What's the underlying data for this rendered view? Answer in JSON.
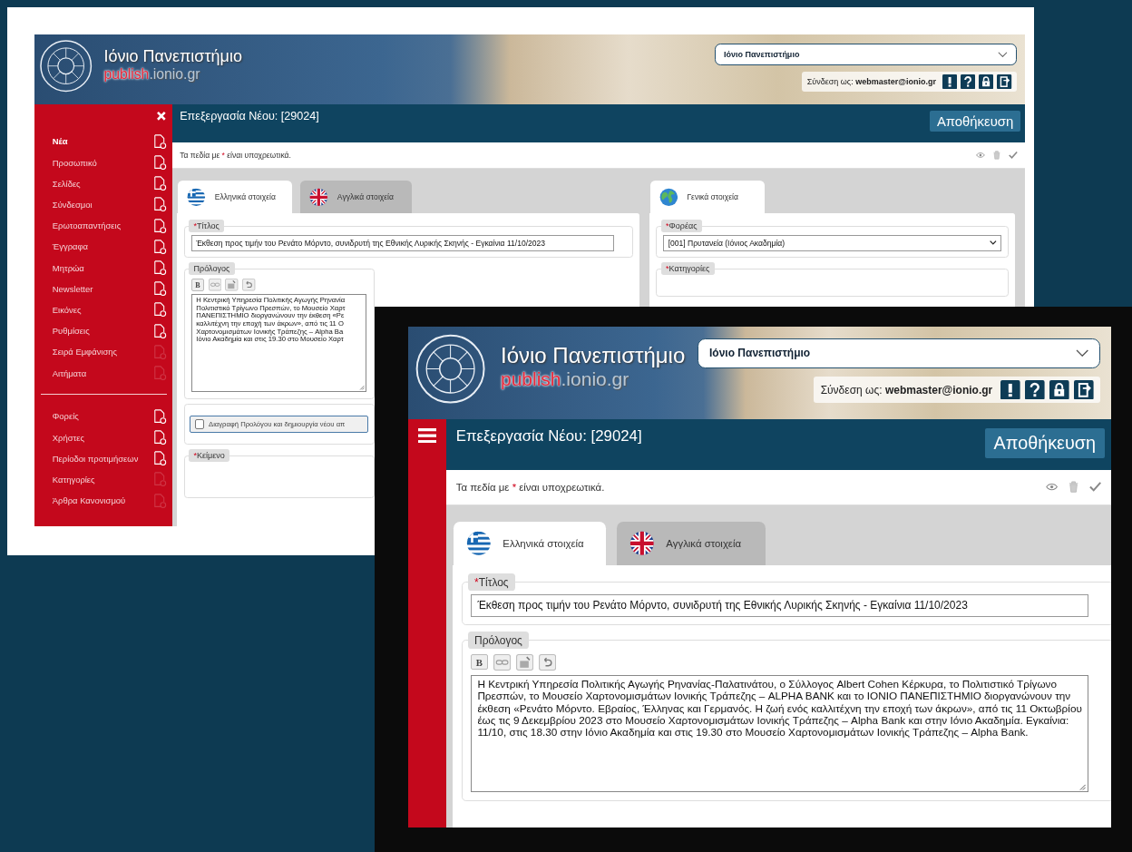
{
  "back_window": {
    "header": {
      "title": "Ιόνιο Πανεπιστήμιο",
      "subtitle": {
        "main": "publish",
        "domain": ".ionio.gr"
      },
      "site_select": "Ιόνιο Πανεπιστήμιο",
      "login": "Σύνδεση ως: **webmaster@ionio.gr**"
    },
    "sidebar": {
      "expanded": true,
      "groups": [
        [
          {
            "label": "Νέα",
            "selected": true,
            "can_add": true
          },
          {
            "label": "Προσωπικό",
            "selected": false,
            "can_add": true
          },
          {
            "label": "Σελίδες",
            "selected": false,
            "can_add": true
          },
          {
            "label": "Σύνδεσμοι",
            "selected": false,
            "can_add": true
          },
          {
            "label": "Ερωτοαπαντήσεις",
            "selected": false,
            "can_add": true
          },
          {
            "label": "Έγγραφα",
            "selected": false,
            "can_add": true
          },
          {
            "label": "Μητρώα",
            "selected": false,
            "can_add": true
          },
          {
            "label": "Newsletter",
            "selected": false,
            "can_add": true
          },
          {
            "label": "Εικόνες",
            "selected": false,
            "can_add": true
          },
          {
            "label": "Ρυθμίσεις",
            "selected": false,
            "can_add": true
          },
          {
            "label": "Σειρά Εμφάνισης",
            "selected": false,
            "can_add": false
          },
          {
            "label": "Αιτήματα",
            "selected": false,
            "can_add": false
          }
        ],
        [
          {
            "label": "Φορείς",
            "selected": false,
            "can_add": true
          },
          {
            "label": "Χρήστες",
            "selected": false,
            "can_add": true
          },
          {
            "label": "Περίοδοι προτιμήσεων",
            "selected": false,
            "can_add": true
          },
          {
            "label": "Κατηγορίες",
            "selected": false,
            "can_add": false
          },
          {
            "label": "Άρθρα Κανονισμού",
            "selected": false,
            "can_add": false
          }
        ]
      ]
    },
    "page_title": "Επεξεργασία Νέου: [29024]",
    "save_button": "Αποθήκευση",
    "notice": {
      "before": "Τα πεδία με",
      "mark": "*",
      "after": "είναι υποχρεωτικά."
    },
    "tabs": [
      {
        "label": "Ελληνικά στοιχεία",
        "kind": "greece",
        "selected": true
      },
      {
        "label": "Αγγλικά στοιχεία",
        "kind": "uk",
        "selected": false
      }
    ],
    "fields": [
      {
        "kind": "input",
        "mark": "*",
        "label": "Τίτλος",
        "value": "Έκθεση προς τιμήν του Ρενάτο Μόρντο, συνιδρυτή της Εθνικής Λυρικής Σκηνής - Εγκαίνια 11/10/2023"
      },
      {
        "kind": "editor",
        "label": "Πρόλογος",
        "toolbar": [
          {
            "kind": "bold",
            "label": "B"
          },
          {
            "kind": "link"
          },
          {
            "kind": "image"
          },
          {
            "kind": "undo"
          }
        ],
        "lines": [
          "Η Κεντρική Υπηρεσία Πολιτικής Αγωγής Ρηνανία",
          "Πολιτιστικό Τρίγωνο Πρεσπών, το Μουσείο Χαρτ",
          "ΠΑΝΕΠΙΣΤΗΜΙΟ διοργανώνουν την έκθεση «Ρε",
          "καλλιτέχνη την εποχή των άκρων», από τις 11 Ο",
          "Χαρτονομισμάτων Ιονικής Τράπεζης – Alpha Ba",
          "Ιόνιο Ακαδημία και στις 19.30 στο Μουσείο Χαρτ"
        ]
      },
      {
        "kind": "checkbox",
        "label": "Διαγραφή Προλόγου και δημιουργία νέου απ",
        "checked": false
      },
      {
        "kind": "heading",
        "mark": "*",
        "label": "Κείμενο"
      }
    ],
    "side_tabs": [
      {
        "label": "Γενικά στοιχεία",
        "kind": "globe",
        "selected": true
      }
    ],
    "side_fields": [
      {
        "kind": "select",
        "mark": "*",
        "label": "Φορέας",
        "value": "[001] Πρυτανεία (Ιόνιος Ακαδημία)"
      },
      {
        "kind": "heading",
        "mark": "*",
        "label": "Κατηγορίες"
      }
    ]
  },
  "front_window": {
    "header": {
      "title": "Ιόνιο Πανεπιστήμιο",
      "subtitle": {
        "main": "publish",
        "domain": ".ionio.gr"
      },
      "site_select": "Ιόνιο Πανεπιστήμιο",
      "login": "Σύνδεση ως: **webmaster@ionio.gr**"
    },
    "sidebar": {
      "expanded": false
    },
    "page_title": "Επεξεργασία Νέου: [29024]",
    "save_button": "Αποθήκευση",
    "notice": {
      "before": "Τα πεδία με",
      "mark": "*",
      "after": "είναι υποχρεωτικά."
    },
    "tabs": [
      {
        "label": "Ελληνικά στοιχεία",
        "kind": "greece",
        "selected": true
      },
      {
        "label": "Αγγλικά στοιχεία",
        "kind": "uk",
        "selected": false
      }
    ],
    "fields": [
      {
        "kind": "input",
        "mark": "*",
        "label": "Τίτλος",
        "value": "Έκθεση προς τιμήν του Ρενάτο Μόρντο, συνιδρυτή της Εθνικής Λυρικής Σκηνής - Εγκαίνια 11/10/2023"
      },
      {
        "kind": "editor",
        "label": "Πρόλογος",
        "toolbar": [
          {
            "kind": "bold",
            "label": "B"
          },
          {
            "kind": "link"
          },
          {
            "kind": "image"
          },
          {
            "kind": "undo"
          }
        ],
        "lines": [
          "Η Κεντρική Υπηρεσία Πολιτικής Αγωγής Ρηνανίας-Παλατινάτου, ο Σύλλογος Albert Cohen Κέρκυρα, το Πολιτιστικό Τρίγωνο",
          "Πρεσπών, το Μουσείο Χαρτονομισμάτων Ιονικής Τράπεζης – ALPHA BANK και το ΙΟΝΙΟ ΠΑΝΕΠΙΣΤΗΜΙΟ διοργανώνουν την",
          "έκθεση «Ρενάτο Μόρντο. Εβραίος, Έλληνας και Γερμανός. Η ζωή ενός καλλιτέχνη την εποχή των άκρων», από τις 11 Οκτωβρίου",
          "έως τις 9 Δεκεμβρίου 2023 στο Μουσείο Χαρτονομισμάτων Ιονικής Τράπεζης – Alpha Bank και στην Ιόνιο Ακαδημία. Εγκαίνια:",
          "11/10, στις 18.30 στην Ιόνιο Ακαδημία και στις 19.30 στο Μουσείο Χαρτονομισμάτων Ιονικής Τράπεζης – Alpha Bank."
        ]
      }
    ]
  }
}
